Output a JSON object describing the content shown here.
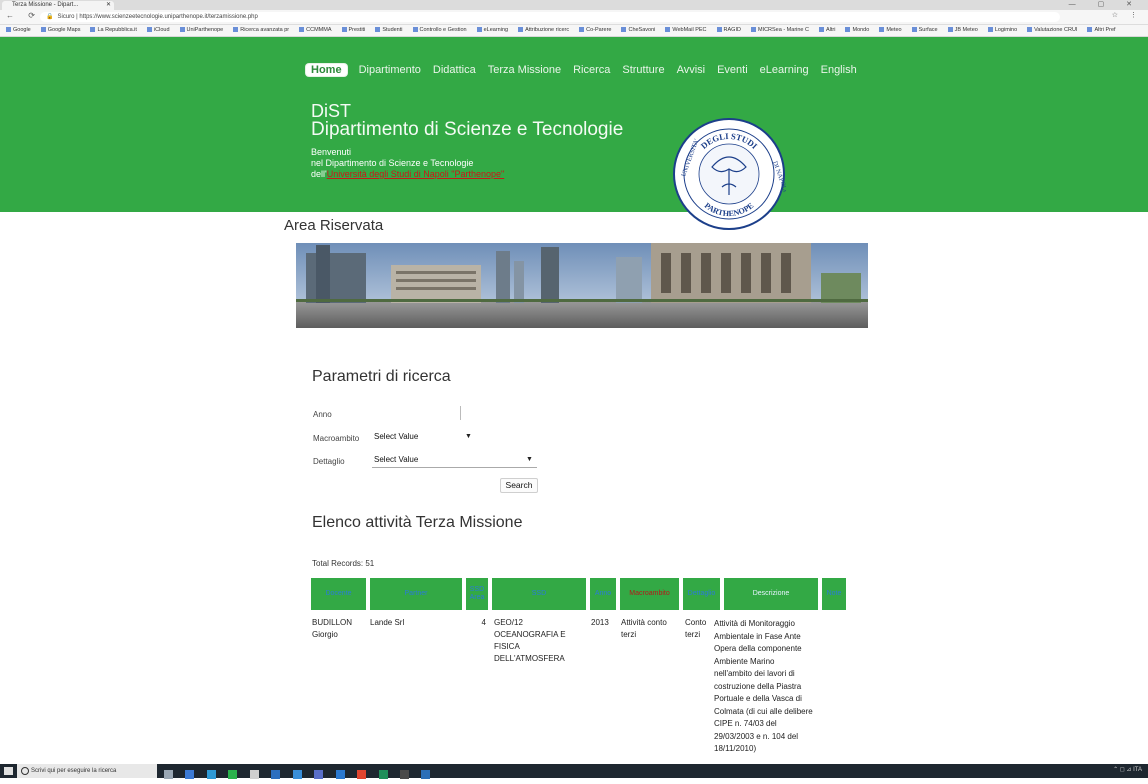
{
  "browser": {
    "tab_title": "Terza Missione - Dipart...",
    "tab_close": "✕",
    "nav": "← ⟳ ⌂",
    "url_secure": "Sicuro",
    "url": "https://www.scienzeetecnologie.uniparthenope.it/terzamissione.php",
    "bookmarks": [
      "Google",
      "Google Maps",
      "La Repubblica.it",
      "iCloud",
      "UniParthenope",
      "Ricerca avanzata pr",
      "CCMMMA",
      "Prestiti",
      "Studenti",
      "Controllo e Gestion",
      "eLearning",
      "Attribuzione ricerc",
      "Co-Parere",
      "CheSavoni",
      "WebMail PEC",
      "RAGID",
      "MICRSea - Marine C",
      "Altri",
      "Mondo",
      "Meteo",
      "Surface",
      "JB Meteo",
      "Logimino",
      "Valutazione CRUI",
      "Altri Pref"
    ]
  },
  "topnav": {
    "items": [
      "Home",
      "Dipartimento",
      "Didattica",
      "Terza Missione",
      "Ricerca",
      "Strutture",
      "Avvisi",
      "Eventi",
      "eLearning",
      "English"
    ]
  },
  "header": {
    "acronym": "DiST",
    "department": "Dipartimento di Scienze e Tecnologie",
    "welcome_1": "Benvenuti",
    "welcome_2": "nel Dipartimento di Scienze e Tecnologie",
    "welcome_3_prefix": "dell'",
    "welcome_3_link": "Università degli Studi di Napoli \"Parthenope\"",
    "seal_top": "DEGLI STUDI",
    "seal_left": "UNIVERSITA'",
    "seal_right": "DI NAPOLI",
    "seal_bottom": "PARTHENOPE"
  },
  "area_title": "Area Riservata",
  "search_form": {
    "title": "Parametri di ricerca",
    "anno_label": "Anno",
    "anno_value": "",
    "macroambito_label": "Macroambito",
    "macroambito_value": "Select Value",
    "dettaglio_label": "Dettaglio",
    "dettaglio_value": "Select Value",
    "search_label": "Search"
  },
  "list": {
    "title": "Elenco attività Terza Missione",
    "total": "Total Records: 51",
    "columns": [
      "Docente",
      "Partner",
      "SSD Area",
      "SSD",
      "Anno",
      "Macroambito",
      "Dettaglio",
      "Descrizione",
      "Note"
    ],
    "row": {
      "docente": "BUDILLON Giorgio",
      "partner": "Lande Srl",
      "ssd_area": "4",
      "ssd": "GEO/12 OCEANOGRAFIA E FISICA DELL'ATMOSFERA",
      "anno": "2013",
      "macroambito": "Attività conto terzi",
      "dettaglio": "Conto terzi",
      "descrizione": "Attività di Monitoraggio Ambientale in Fase Ante Opera della componente Ambiente Marino nell'ambito dei lavori di costruzione della Piastra Portuale e della Vasca di Colmata (di cui alle delibere CIPE n. 74/03 del 29/03/2003 e n. 104 del 18/11/2010)"
    }
  },
  "taskbar": {
    "search_placeholder": "Scrivi qui per eseguire la ricerca",
    "tray": "⌃ ◻ ⊿ ITA"
  },
  "colors": {
    "header_green": "#33a945",
    "link_red": "#c91818"
  }
}
